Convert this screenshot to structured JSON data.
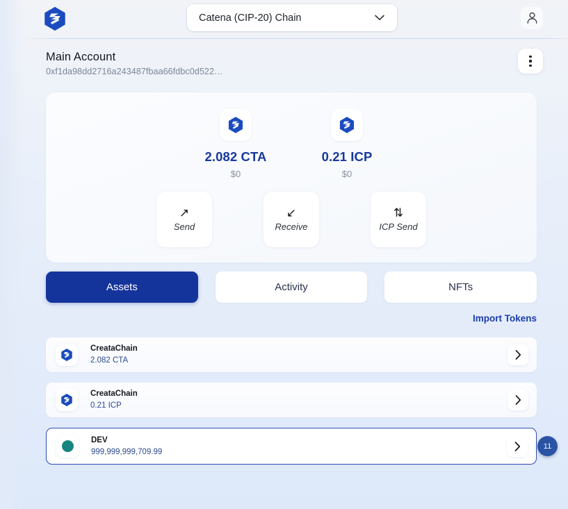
{
  "header": {
    "logo_icon": "creatachain-hex-logo-icon",
    "chain_selector": {
      "value": "Catena (CIP-20) Chain",
      "chevron_icon": "chevron-down-icon"
    },
    "profile_icon": "user-account-icon"
  },
  "account": {
    "name": "Main Account",
    "address": "0xf1da98dd2716a243487fbaa66fdbc0d522…",
    "menu_icon": "kebab-menu-icon"
  },
  "balances": {
    "tokens": [
      {
        "icon": "creatachain-hex-logo-icon",
        "amount": "2.082 CTA",
        "fiat": "$0"
      },
      {
        "icon": "creatachain-hex-logo-icon",
        "amount": "0.21 ICP",
        "fiat": "$0"
      }
    ],
    "actions": [
      {
        "label": "Send",
        "glyph": "↗",
        "icon": "send-arrow-icon"
      },
      {
        "label": "Receive",
        "glyph": "↙",
        "icon": "receive-arrow-icon"
      },
      {
        "label": "ICP Send",
        "glyph": "⇅",
        "icon": "icp-transfer-icon"
      }
    ]
  },
  "tabs": [
    {
      "label": "Assets",
      "active": true
    },
    {
      "label": "Activity",
      "active": false
    },
    {
      "label": "NFTs",
      "active": false
    }
  ],
  "import_tokens_label": "Import Tokens",
  "assets": [
    {
      "name": "CreataChain",
      "balance": "2.082 CTA",
      "icon": "creatachain-hex-logo-icon",
      "selected": false,
      "badge": null
    },
    {
      "name": "CreataChain",
      "balance": "0.21 ICP",
      "icon": "creatachain-hex-logo-icon",
      "selected": false,
      "badge": null
    },
    {
      "name": "DEV",
      "balance": "999,999,999,709.99",
      "icon": "teal-dot-icon",
      "selected": true,
      "badge": "11"
    }
  ],
  "colors": {
    "accent_blue": "#15349b",
    "link_blue": "#1b3da8",
    "amount_blue": "#18399c",
    "badge_blue": "#2a52a5",
    "dev_token_teal": "#17857f",
    "page_background": "#dde9f9"
  }
}
